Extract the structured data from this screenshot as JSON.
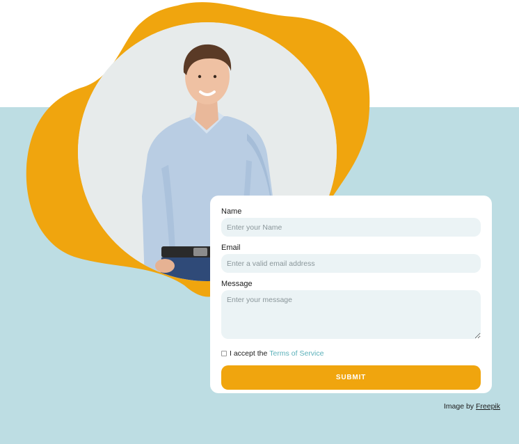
{
  "colors": {
    "background_band": "#bddde3",
    "blob_accent": "#f0a50e",
    "input_background": "#ebf3f5",
    "button_background": "#f0a50e",
    "link_color": "#5ab0b9"
  },
  "hero": {
    "image_icon": "person-photo"
  },
  "form": {
    "name_label": "Name",
    "name_placeholder": "Enter your Name",
    "email_label": "Email",
    "email_placeholder": "Enter a valid email address",
    "message_label": "Message",
    "message_placeholder": "Enter your message",
    "terms_prefix": "I accept the",
    "terms_link": "Terms of Service",
    "submit_label": "SUBMIT"
  },
  "credit": {
    "prefix": "Image by",
    "link": "Freepik"
  }
}
